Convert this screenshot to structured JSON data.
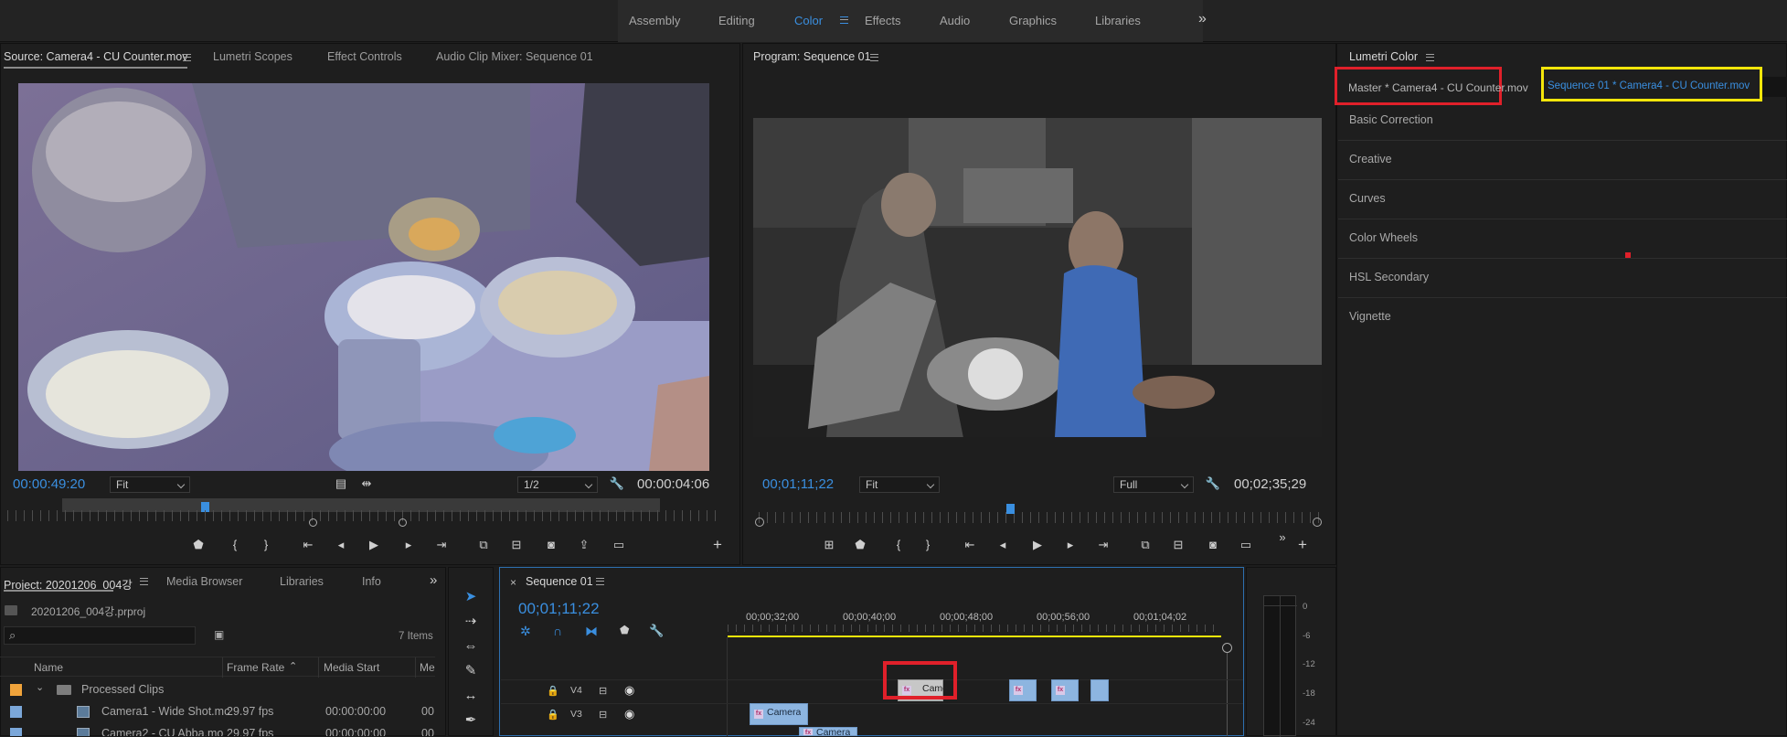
{
  "workspaces": [
    "Assembly",
    "Editing",
    "Color",
    "Effects",
    "Audio",
    "Graphics",
    "Libraries"
  ],
  "workspace_active": "Color",
  "workspace_more": "»",
  "source_panel": {
    "tabs": [
      "Source: Camera4 - CU Counter.mov",
      "Lumetri Scopes",
      "Effect Controls",
      "Audio Clip Mixer: Sequence 01"
    ],
    "timecode_in": "00:00:49:20",
    "fit": "Fit",
    "resolution": "1/2",
    "duration": "00:00:04:06"
  },
  "program_panel": {
    "title": "Program: Sequence 01",
    "timecode": "00;01;11;22",
    "fit": "Fit",
    "resolution": "Full",
    "duration": "00;02;35;29"
  },
  "lumetri": {
    "title": "Lumetri Color",
    "master_tab": "Master * Camera4 - CU Counter.mov",
    "sequence_tab": "Sequence 01 * Camera4 - CU Counter.mov",
    "sections": [
      "Basic Correction",
      "Creative",
      "Curves",
      "Color Wheels",
      "HSL Secondary",
      "Vignette"
    ]
  },
  "project_panel": {
    "tabs": [
      "Project: 20201206_004강",
      "Media Browser",
      "Libraries",
      "Info"
    ],
    "file": "20201206_004강.prproj",
    "items_count": "7 Items",
    "columns": [
      "Name",
      "Frame Rate",
      "Media Start",
      "Me"
    ],
    "rows": [
      {
        "name": "Processed Clips",
        "rate": "",
        "start": "",
        "me": ""
      },
      {
        "name": "Camera1 - Wide Shot.mc",
        "rate": "29.97 fps",
        "start": "00:00:00:00",
        "me": "00"
      },
      {
        "name": "Camera2 - CU Abba.mo",
        "rate": "29.97 fps",
        "start": "00:00:00:00",
        "me": "00"
      }
    ]
  },
  "timeline": {
    "tab": "Sequence 01",
    "timecode": "00;01;11;22",
    "ruler": [
      "00;00;32;00",
      "00;00;40;00",
      "00;00;48;00",
      "00;00;56;00",
      "00;01;04;02"
    ],
    "tracks": [
      "V4",
      "V3"
    ],
    "clips": {
      "v4_first": "Came",
      "v3_first": "Camera",
      "v2_first": "Camera"
    },
    "fx_badge": "fx"
  },
  "meter_labels": [
    "0",
    "-6",
    "-12",
    "-18",
    "-24"
  ],
  "colors": {
    "accent_blue": "#3a8fe0",
    "highlight_red": "#e0202a",
    "highlight_yellow": "#f4e60a",
    "clip_blue": "#8db5e0"
  }
}
